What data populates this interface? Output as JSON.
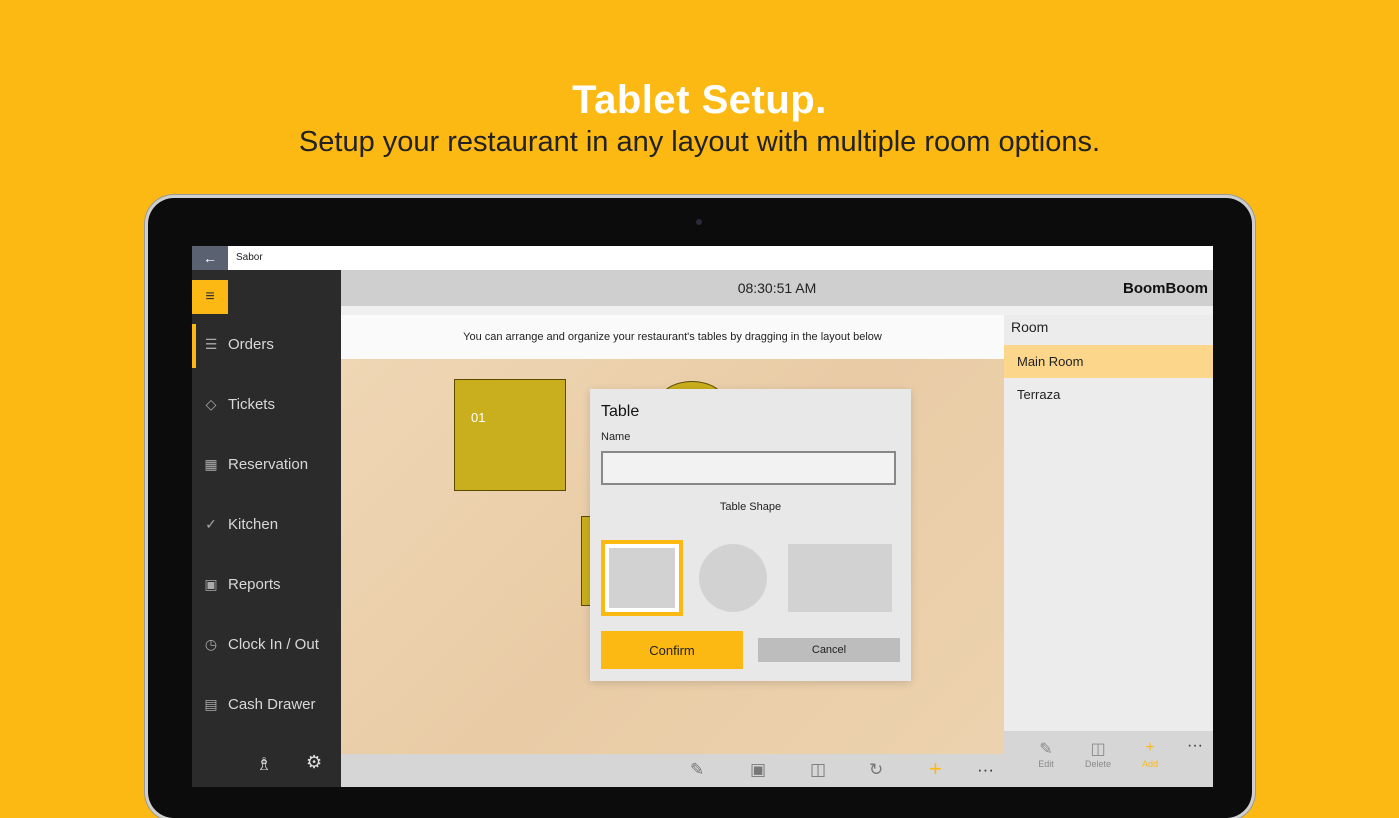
{
  "hero": {
    "title": "Tablet Setup.",
    "subtitle": "Setup your restaurant in any layout with multiple room options."
  },
  "window": {
    "app_name": "Sabor",
    "back_icon": "back-arrow-icon"
  },
  "sidebar": {
    "menu_icon": "hamburger-icon",
    "items": [
      {
        "label": "Orders",
        "icon": "list-icon",
        "active": true
      },
      {
        "label": "Tickets",
        "icon": "tag-icon",
        "active": false
      },
      {
        "label": "Reservation",
        "icon": "calendar-icon",
        "active": false
      },
      {
        "label": "Kitchen",
        "icon": "checklist-icon",
        "active": false
      },
      {
        "label": "Reports",
        "icon": "report-icon",
        "active": false
      },
      {
        "label": "Clock In / Out",
        "icon": "clock-icon",
        "active": false
      },
      {
        "label": "Cash Drawer",
        "icon": "cash-drawer-icon",
        "active": false
      }
    ],
    "bottom_icons": [
      "user-icon",
      "gear-icon"
    ]
  },
  "header": {
    "time": "08:30:51 AM",
    "brand": "BoomBoom"
  },
  "layout": {
    "info_text": "You can arrange and organize your restaurant's tables by dragging in the layout below",
    "tables": [
      {
        "name": "01"
      }
    ]
  },
  "dialog": {
    "title": "Table",
    "name_label": "Name",
    "name_value": "",
    "shape_label": "Table Shape",
    "shapes": [
      "square",
      "circle",
      "rectangle"
    ],
    "selected_shape": "square",
    "confirm_label": "Confirm",
    "cancel_label": "Cancel"
  },
  "rooms": {
    "header": "Room",
    "items": [
      {
        "label": "Main Room",
        "selected": true
      },
      {
        "label": "Terraza",
        "selected": false
      }
    ],
    "toolbar": {
      "edit_label": "Edit",
      "delete_label": "Delete",
      "add_label": "Add",
      "more": "···"
    }
  },
  "bottom_toolbar": {
    "icons": [
      "pencil-icon",
      "save-icon",
      "trash-icon",
      "rotate-icon",
      "plus-icon",
      "more-icon"
    ],
    "more": "···"
  },
  "colors": {
    "accent": "#FDB913",
    "table": "#C9AE1D",
    "sidebar": "#2B2B2B"
  }
}
